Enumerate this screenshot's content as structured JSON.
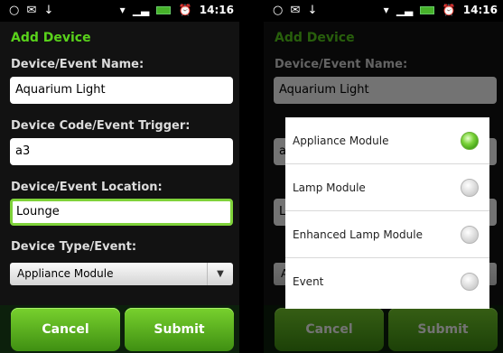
{
  "status": {
    "time": "14:16",
    "left_icons": "○ ✉ ↓"
  },
  "form": {
    "title": "Add Device",
    "name_label": "Device/Event Name:",
    "name_value": "Aquarium Light",
    "code_label": "Device Code/Event Trigger:",
    "code_value": "a3",
    "location_label": "Device/Event Location:",
    "location_value": "Lounge",
    "type_label": "Device Type/Event:",
    "type_value": "Appliance Module",
    "cancel_label": "Cancel",
    "submit_label": "Submit"
  },
  "dialog": {
    "options": [
      {
        "label": "Appliance Module",
        "selected": true
      },
      {
        "label": "Lamp Module",
        "selected": false
      },
      {
        "label": "Enhanced Lamp Module",
        "selected": false
      },
      {
        "label": "Event",
        "selected": false
      }
    ]
  },
  "colors": {
    "accent_green": "#59d21b",
    "button_green": "#5bb21f"
  }
}
